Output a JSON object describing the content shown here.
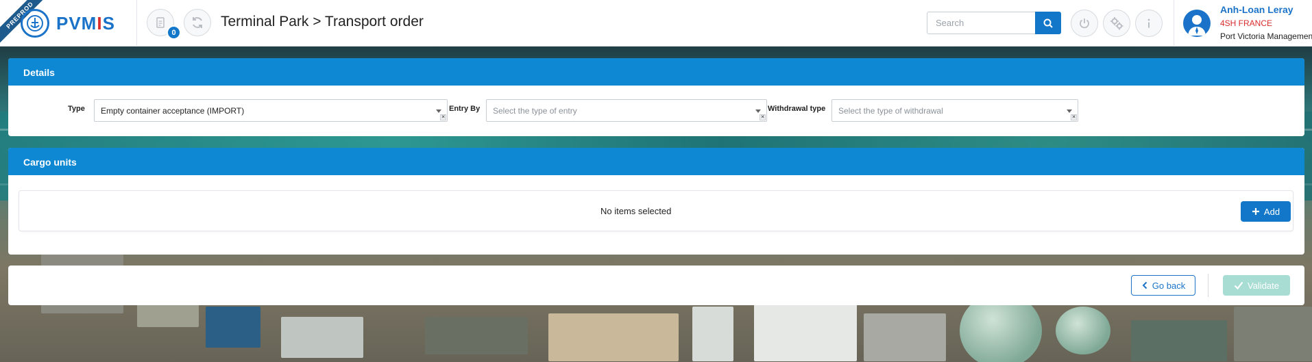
{
  "app": {
    "env_ribbon": "PREPROD",
    "logo_pre": "PVM",
    "logo_accent": "I",
    "logo_post": "S",
    "notification_count": "0",
    "breadcrumb": "Terminal Park > Transport order"
  },
  "search": {
    "placeholder": "Search"
  },
  "user": {
    "name": "Anh-Loan Leray",
    "company": "4SH FRANCE",
    "organization": "Port Victoria Management"
  },
  "details": {
    "title": "Details",
    "type_label": "Type",
    "type_value": "Empty container acceptance (IMPORT)",
    "entry_label": "Entry By",
    "entry_placeholder": "Select the type of entry",
    "withdrawal_label": "Withdrawal type",
    "withdrawal_placeholder": "Select the type of withdrawal"
  },
  "cargo": {
    "title": "Cargo units",
    "empty_text": "No items selected",
    "add_label": "Add"
  },
  "footer": {
    "back_label": "Go back",
    "validate_label": "Validate"
  },
  "colors": {
    "primary": "#1277c9",
    "panel_header": "#0e88d3",
    "accent_red": "#d92b2b",
    "validate_disabled": "#a8ddd4"
  },
  "icons": [
    "document-icon",
    "refresh-icon",
    "search-icon",
    "power-icon",
    "settings-icon",
    "info-icon",
    "user-avatar-icon",
    "plus-icon",
    "chevron-left-icon",
    "check-icon"
  ]
}
